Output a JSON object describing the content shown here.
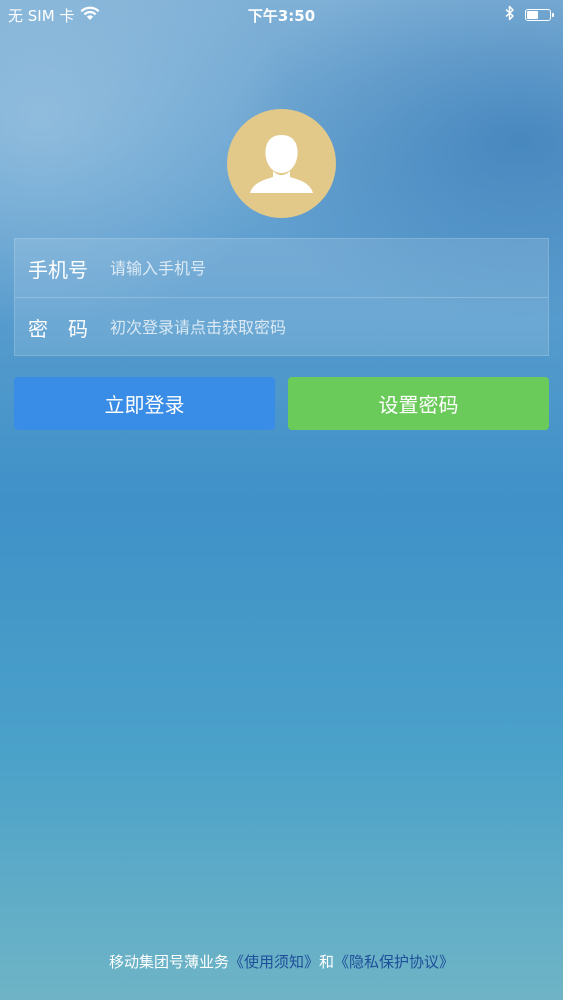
{
  "status_bar": {
    "carrier": "无 SIM 卡",
    "time": "下午3:50",
    "icons": [
      "wifi-icon",
      "bluetooth-icon",
      "battery-icon"
    ],
    "battery_percent": 50
  },
  "avatar": {
    "icon": "user-silhouette-icon",
    "color": "#e2c98a"
  },
  "form": {
    "phone": {
      "label": "手机号",
      "placeholder": "请输入手机号",
      "value": ""
    },
    "password": {
      "label": "密　码",
      "placeholder": "初次登录请点击获取密码",
      "value": ""
    }
  },
  "buttons": {
    "login": {
      "label": "立即登录",
      "color": "#3a8de6"
    },
    "set_password": {
      "label": "设置密码",
      "color": "#6bcb5a"
    }
  },
  "footer": {
    "prefix": "移动集团号薄业务",
    "terms_link": "《使用须知》",
    "conjunction": "和",
    "privacy_link": "《隐私保护协议》"
  }
}
